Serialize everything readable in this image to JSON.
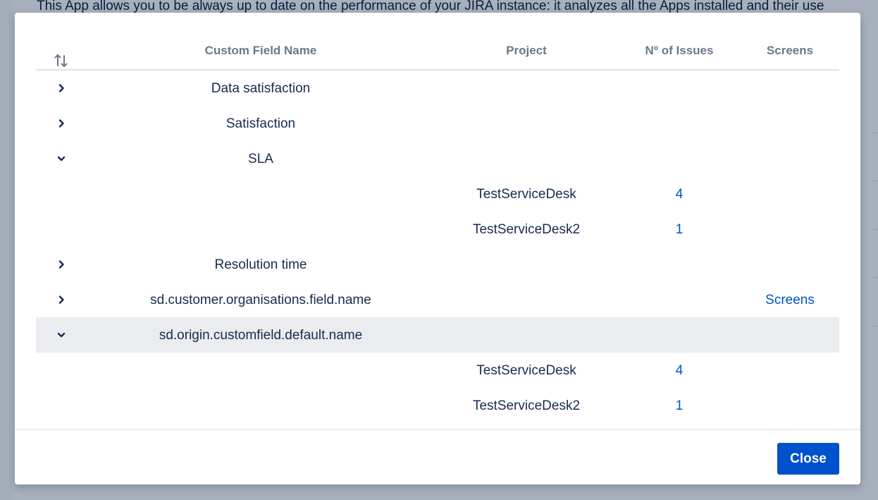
{
  "background": {
    "intro_text": "This App allows you to be always up to date on the performance of your JIRA instance: it analyzes all the Apps installed and their use"
  },
  "table": {
    "sort_icon": "sort-arrows-icon",
    "headers": {
      "name": "Custom Field Name",
      "project": "Project",
      "issues": "Nº of Issues",
      "screens": "Screens"
    },
    "rows": [
      {
        "type": "field",
        "expanded": false,
        "name": "Data satisfaction",
        "screens": ""
      },
      {
        "type": "field",
        "expanded": false,
        "name": "Satisfaction",
        "screens": ""
      },
      {
        "type": "field",
        "expanded": true,
        "name": "SLA",
        "screens": ""
      },
      {
        "type": "project",
        "project": "TestServiceDesk",
        "issues": "4"
      },
      {
        "type": "project",
        "project": "TestServiceDesk2",
        "issues": "1"
      },
      {
        "type": "field",
        "expanded": false,
        "name": "Resolution time",
        "screens": ""
      },
      {
        "type": "field",
        "expanded": false,
        "name": "sd.customer.organisations.field.name",
        "screens": "Screens"
      },
      {
        "type": "field",
        "expanded": true,
        "name": "sd.origin.customfield.default.name",
        "screens": "",
        "highlight": true
      },
      {
        "type": "project",
        "project": "TestServiceDesk",
        "issues": "4"
      },
      {
        "type": "project",
        "project": "TestServiceDesk2",
        "issues": "1"
      }
    ]
  },
  "footer": {
    "close_label": "Close"
  },
  "colors": {
    "link": "#0052cc",
    "primary_button": "#0052cc",
    "row_highlight": "#ebecf0"
  }
}
